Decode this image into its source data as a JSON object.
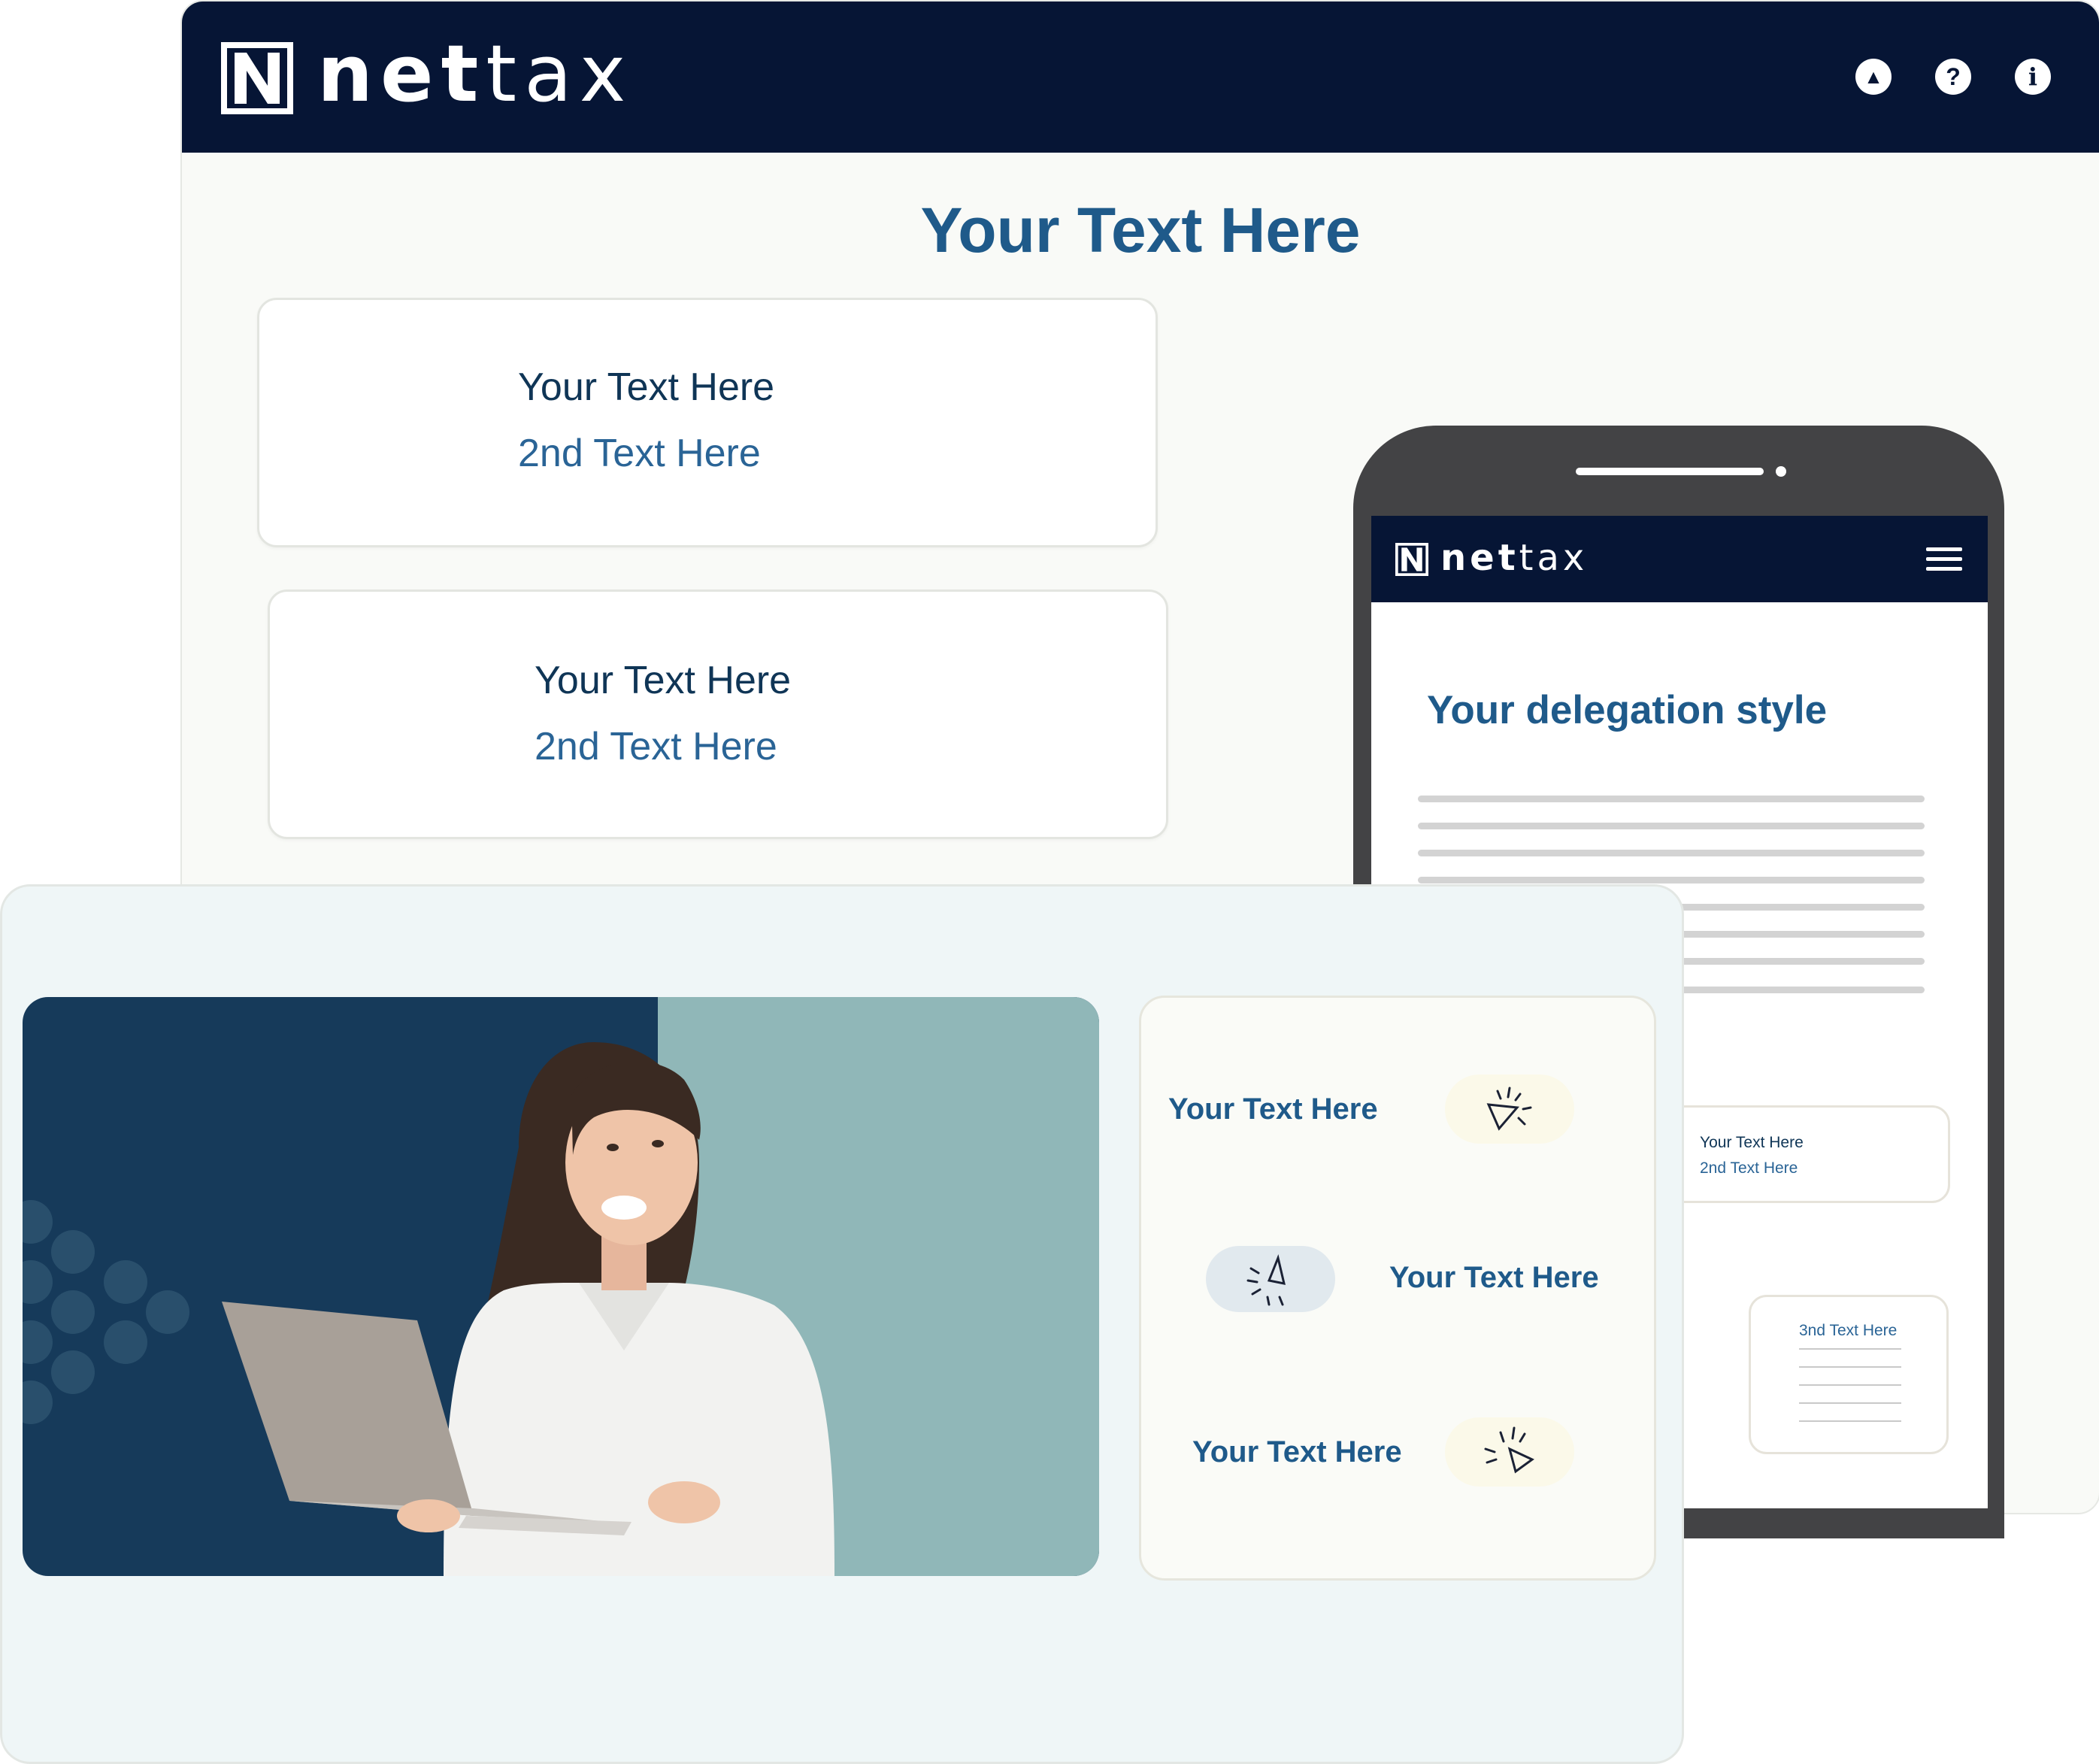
{
  "brand": {
    "logo_letter": "N",
    "name_bold": "net",
    "name_light": "tax",
    "colors": {
      "navy": "#061535",
      "title_blue": "#1f5a8a",
      "teal": "#90b7b8",
      "hero_navy": "#163a5a",
      "page_bg": "#f9faf7"
    }
  },
  "desktop": {
    "header_icons": [
      {
        "name": "up-arrow-icon",
        "glyph": "▲"
      },
      {
        "name": "help-icon",
        "glyph": "?"
      },
      {
        "name": "info-icon",
        "glyph": "i"
      }
    ],
    "title": "Your Text Here",
    "cards": [
      {
        "main": "Your Text Here",
        "sub": "2nd Text Here"
      },
      {
        "main": "Your Text Here",
        "sub": "2nd Text Here"
      }
    ]
  },
  "phone": {
    "menu_icon": "hamburger-menu-icon",
    "title": "Your delegation style",
    "mini_card": {
      "main": "Your Text Here",
      "sub": "2nd Text Here"
    },
    "third_card": {
      "label": "3nd Text Here"
    }
  },
  "features": [
    {
      "text": "Your Text Here",
      "icon": "cursor-click-icon"
    },
    {
      "text": "Your Text Here",
      "icon": "cursor-click-icon"
    },
    {
      "text": "Your Text Here",
      "icon": "cursor-click-icon"
    }
  ]
}
